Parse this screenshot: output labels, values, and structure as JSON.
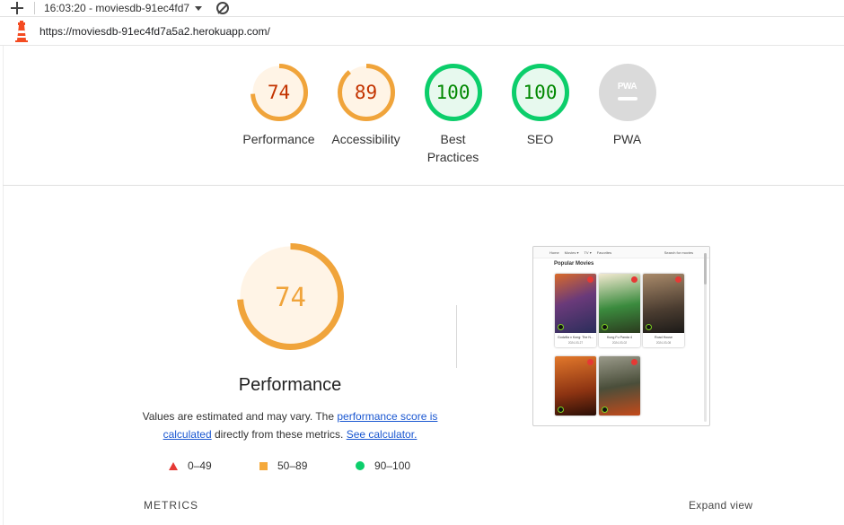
{
  "toolbar": {
    "report_label": "16:03:20 - moviesdb-91ec4fd7"
  },
  "url": "https://moviesdb-91ec4fd7a5a2.herokuapp.com/",
  "gauges": [
    {
      "score": "74",
      "label": "Performance",
      "value": 0.74,
      "color": "#f0a43b"
    },
    {
      "score": "89",
      "label": "Accessibility",
      "value": 0.89,
      "color": "#f0a43b"
    },
    {
      "score": "100",
      "label": "Best Practices",
      "value": 1.0,
      "color": "#0cce6b"
    },
    {
      "score": "100",
      "label": "SEO",
      "value": 1.0,
      "color": "#0cce6b"
    },
    {
      "score": "",
      "label": "PWA",
      "value": 0,
      "color": "#d9d9d9",
      "badge_text": "PWA"
    }
  ],
  "performance": {
    "score": "74",
    "value": 0.74,
    "title": "Performance",
    "desc_prefix": "Values are estimated and may vary. The ",
    "link1": "performance score is calculated",
    "desc_middle": " directly from these metrics. ",
    "link2": "See calculator."
  },
  "legend": [
    {
      "range": "0–49",
      "shape": "triangle",
      "color": "#e53935"
    },
    {
      "range": "50–89",
      "shape": "square",
      "color": "#f5a93b"
    },
    {
      "range": "90–100",
      "shape": "circle",
      "color": "#0cce6b"
    }
  ],
  "metrics_label": "METRICS",
  "expand_label": "Expand view",
  "thumbnail": {
    "nav": [
      "Home",
      "Movies ▾",
      "TV ▾",
      "Favorites"
    ],
    "search": "Search for movies",
    "heading": "Popular Movies",
    "cards": [
      {
        "title": "Godzilla x Kong: The N...",
        "date": "2024-03-27"
      },
      {
        "title": "Kung Fu Panda 4",
        "date": "2024-03-02"
      },
      {
        "title": "Road House",
        "date": "2024-03-08"
      },
      {
        "title": "",
        "date": ""
      },
      {
        "title": "",
        "date": ""
      }
    ]
  }
}
